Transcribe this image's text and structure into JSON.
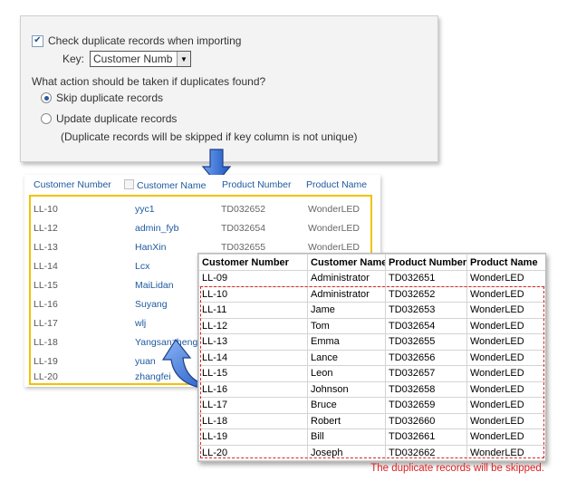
{
  "settings": {
    "check_label": "Check duplicate records when importing",
    "check_checked": true,
    "key_label": "Key:",
    "key_value": "Customer Numb",
    "question": "What action should be taken if duplicates found?",
    "skip_label": "Skip duplicate records",
    "update_label": "Update duplicate records",
    "note": "(Duplicate records will be skipped if key column is not unique)"
  },
  "list": {
    "headers": [
      "Customer Number",
      "Customer Name",
      "Product Number",
      "Product Name"
    ],
    "rows": [
      [
        "LL-10",
        "yyc1",
        "TD032652",
        "WonderLED"
      ],
      [
        "LL-12",
        "admin_fyb",
        "TD032654",
        "WonderLED"
      ],
      [
        "LL-13",
        "HanXin",
        "TD032655",
        "WonderLED"
      ],
      [
        "LL-14",
        "Lcx",
        "",
        ""
      ],
      [
        "LL-15",
        "MaiLidan",
        "",
        ""
      ],
      [
        "LL-16",
        "Suyang",
        "",
        ""
      ],
      [
        "LL-17",
        "wlj",
        "",
        ""
      ],
      [
        "LL-18",
        "Yangsanzheng",
        "",
        ""
      ],
      [
        "LL-19",
        "yuan",
        "",
        ""
      ],
      [
        "LL-20",
        "zhangfei",
        "",
        ""
      ]
    ]
  },
  "import_table": {
    "headers": [
      "Customer Number",
      "Customer Name",
      "Product Number",
      "Product Name"
    ],
    "rows": [
      [
        "LL-09",
        "Administrator",
        "TD032651",
        "WonderLED"
      ],
      [
        "LL-10",
        "Administrator",
        "TD032652",
        "WonderLED"
      ],
      [
        "LL-11",
        "Jame",
        "TD032653",
        "WonderLED"
      ],
      [
        "LL-12",
        "Tom",
        "TD032654",
        "WonderLED"
      ],
      [
        "LL-13",
        "Emma",
        "TD032655",
        "WonderLED"
      ],
      [
        "LL-14",
        "Lance",
        "TD032656",
        "WonderLED"
      ],
      [
        "LL-15",
        "Leon",
        "TD032657",
        "WonderLED"
      ],
      [
        "LL-16",
        "Johnson",
        "TD032658",
        "WonderLED"
      ],
      [
        "LL-17",
        "Bruce",
        "TD032659",
        "WonderLED"
      ],
      [
        "LL-18",
        "Robert",
        "TD032660",
        "WonderLED"
      ],
      [
        "LL-19",
        "Bill",
        "TD032661",
        "WonderLED"
      ],
      [
        "LL-20",
        "Joseph",
        "TD032662",
        "WonderLED"
      ]
    ]
  },
  "caption": "The duplicate records will be skipped.",
  "colors": {
    "highlight_border": "#f2c200",
    "dash_border": "#dd2222",
    "caption": "#e02020",
    "link": "#1e5aa0",
    "arrow": "#2f6bd6"
  },
  "icons": {
    "down_arrow": "down-arrow-icon",
    "curve_arrow": "curved-arrow-icon"
  }
}
